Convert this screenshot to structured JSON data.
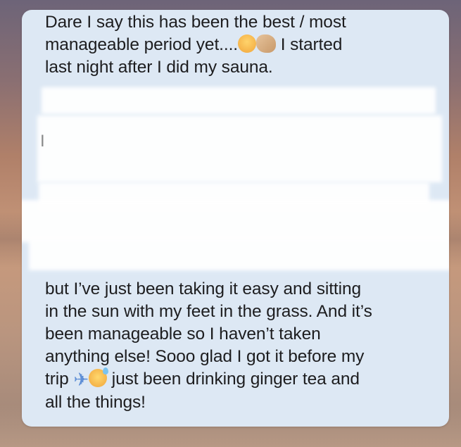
{
  "message": {
    "top_line_1": "Dare I say this has been the best / most",
    "top_line_2": "manageable period yet....",
    "top_line_2_after": " I started",
    "top_line_3": "last night after I did my sauna.",
    "bottom_line_1": "but I’ve just been taking it easy and sitting",
    "bottom_line_2": "in the sun with my feet in the grass. And it’s",
    "bottom_line_3": "been manageable so I haven’t taken",
    "bottom_line_4": "anything else! Sooo glad I got it before my",
    "bottom_line_5_a": "trip",
    "bottom_line_5_b": " just been drinking ginger tea and",
    "bottom_line_6": "all the things!"
  },
  "emojis": {
    "flushed": "flushed-face-icon",
    "clap": "clapping-hands-icon",
    "plane": "airplane-icon",
    "sweat": "grinning-sweat-face-icon"
  },
  "colors": {
    "bubble": "#dde8f4",
    "text": "#1d1d1f",
    "redaction": "#ffffff"
  }
}
